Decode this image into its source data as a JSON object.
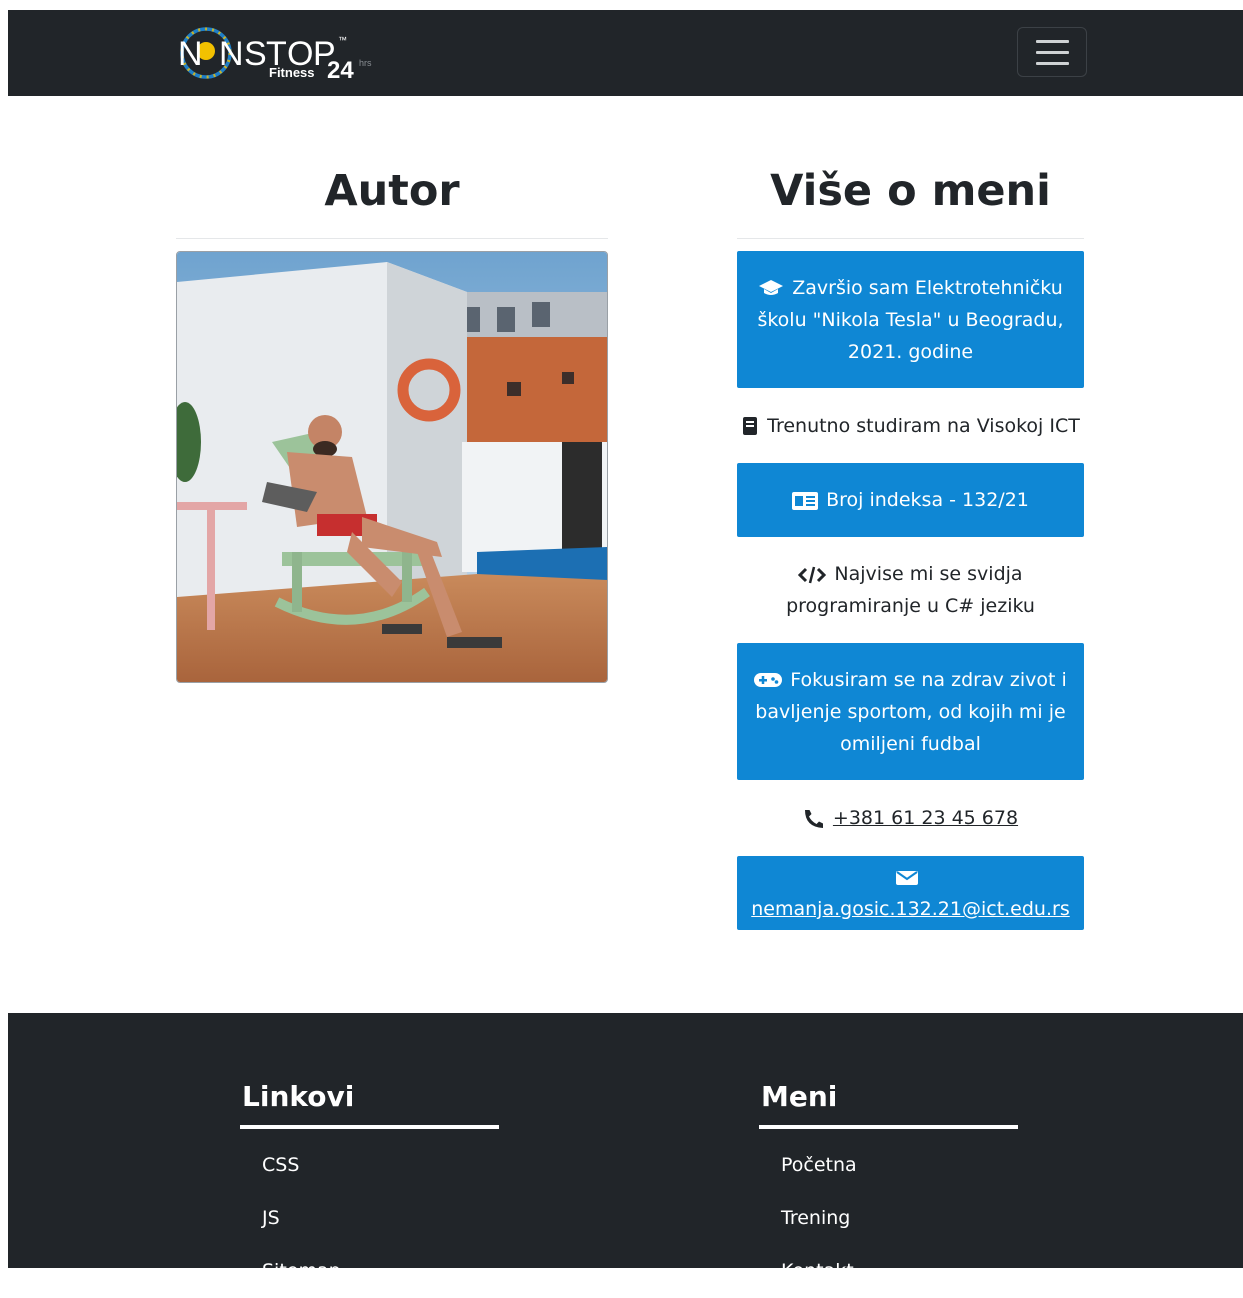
{
  "navbar": {
    "logo": {
      "letters": [
        "N",
        "N",
        "S",
        "T",
        "O",
        "P"
      ],
      "fitness": "Fitness",
      "hours": "24",
      "hrs": "hrs",
      "tm": "™"
    },
    "toggler_icon": "hamburger-icon"
  },
  "author": {
    "title": "Autor"
  },
  "about": {
    "title": "Više o meni",
    "items": [
      {
        "icon": "graduation-cap-icon",
        "text": "Završio sam Elektrotehničku školu \"Nikola Tesla\" u Beogradu, 2021. godine",
        "style": "box"
      },
      {
        "icon": "book-icon",
        "text": "Trenutno studiram na Visokoj ICT",
        "style": "plain"
      },
      {
        "icon": "id-card-icon",
        "text": "Broj indeksa - 132/21",
        "style": "box"
      },
      {
        "icon": "code-icon",
        "text": "Najvise mi se svidja programiranje u C# jeziku",
        "style": "plain"
      },
      {
        "icon": "gamepad-icon",
        "text": "Fokusiram se na zdrav zivot i bavljenje sportom, od kojih mi je omiljeni fudbal",
        "style": "box"
      },
      {
        "icon": "phone-icon",
        "text": "+381 61 23 45 678",
        "style": "plain-link"
      },
      {
        "icon": "envelope-icon",
        "text": "nemanja.gosic.132.21@ict.edu.rs",
        "style": "box-link"
      }
    ]
  },
  "footer": {
    "links": {
      "title": "Linkovi",
      "items": [
        "CSS",
        "JS",
        "Sitemap"
      ]
    },
    "menu": {
      "title": "Meni",
      "items": [
        "Početna",
        "Trening",
        "Kontakt"
      ]
    }
  },
  "colors": {
    "dark": "#212529",
    "accent": "#0f87d4",
    "logo_ring": "#1f7fc7",
    "logo_dot": "#f2c100"
  }
}
